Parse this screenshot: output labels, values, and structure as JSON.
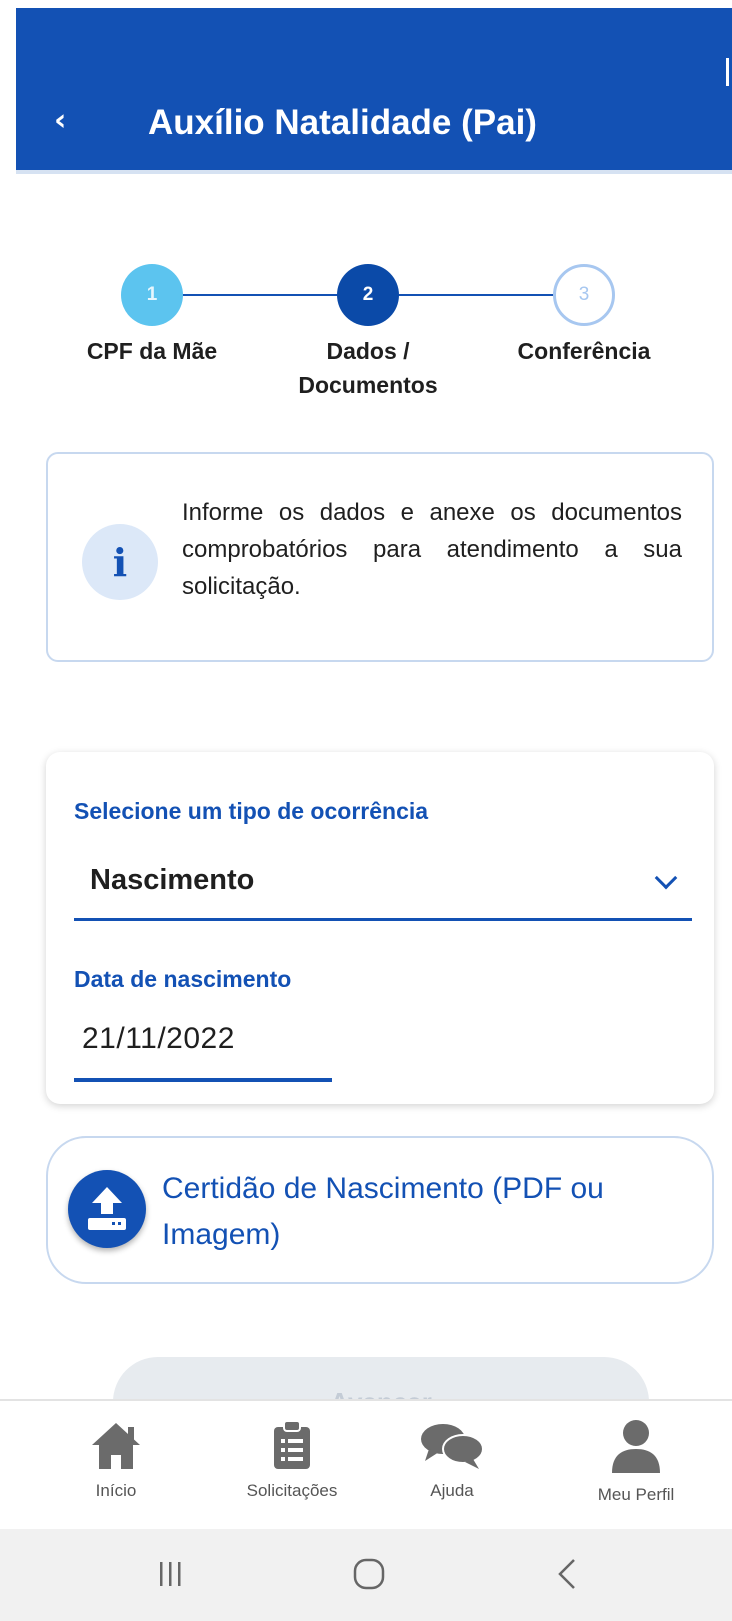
{
  "header": {
    "back_icon": "chevron-left-icon",
    "title": "Auxílio Natalidade (Pai)"
  },
  "stepper": {
    "steps": [
      {
        "number": "1",
        "label": "CPF da Mãe",
        "state": "done"
      },
      {
        "number": "2",
        "label": "Dados / Documentos",
        "state": "active"
      },
      {
        "number": "3",
        "label": "Conferência",
        "state": "todo"
      }
    ]
  },
  "info": {
    "icon": "info-icon",
    "text": "Informe os dados e anexe os documentos comprobatórios para atendimento a sua solicitação."
  },
  "form": {
    "occurrence_label": "Selecione um tipo de ocorrência",
    "occurrence_value": "Nascimento",
    "birth_date_label": "Data de nascimento",
    "birth_date_value": "21/11/2022"
  },
  "upload": {
    "icon": "upload-icon",
    "label": "Certidão de Nascimento (PDF ou Imagem)"
  },
  "advance_button": {
    "label": "Avançar"
  },
  "bottom_nav": {
    "items": [
      {
        "label": "Início",
        "icon": "home-icon"
      },
      {
        "label": "Solicitações",
        "icon": "clipboard-icon"
      },
      {
        "label": "Ajuda",
        "icon": "chat-icon"
      },
      {
        "label": "Meu Perfil",
        "icon": "user-icon"
      }
    ]
  },
  "system_nav": {
    "recent": "recent-apps-icon",
    "home": "home-circle-icon",
    "back": "back-icon"
  },
  "colors": {
    "primary": "#1351b4",
    "step_done": "#5cc4ef",
    "step_active": "#0b4aa8"
  }
}
